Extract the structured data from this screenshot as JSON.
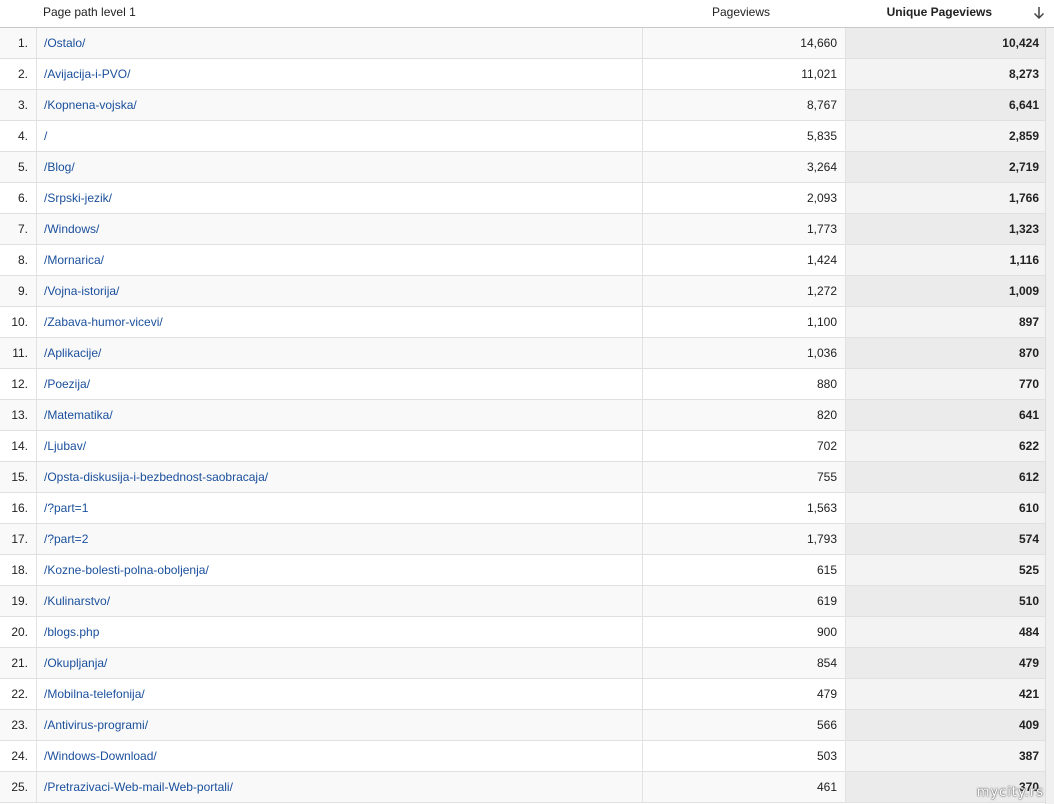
{
  "header": {
    "path_label": "Page path level 1",
    "pageviews_label": "Pageviews",
    "unique_label": "Unique Pageviews"
  },
  "icons": {
    "sort": "arrow-down-icon"
  },
  "rows": [
    {
      "num": "1.",
      "path": "/Ostalo/",
      "pageviews": "14,660",
      "unique": "10,424"
    },
    {
      "num": "2.",
      "path": "/Avijacija-i-PVO/",
      "pageviews": "11,021",
      "unique": "8,273"
    },
    {
      "num": "3.",
      "path": "/Kopnena-vojska/",
      "pageviews": "8,767",
      "unique": "6,641"
    },
    {
      "num": "4.",
      "path": "/",
      "pageviews": "5,835",
      "unique": "2,859"
    },
    {
      "num": "5.",
      "path": "/Blog/",
      "pageviews": "3,264",
      "unique": "2,719"
    },
    {
      "num": "6.",
      "path": "/Srpski-jezik/",
      "pageviews": "2,093",
      "unique": "1,766"
    },
    {
      "num": "7.",
      "path": "/Windows/",
      "pageviews": "1,773",
      "unique": "1,323"
    },
    {
      "num": "8.",
      "path": "/Mornarica/",
      "pageviews": "1,424",
      "unique": "1,116"
    },
    {
      "num": "9.",
      "path": "/Vojna-istorija/",
      "pageviews": "1,272",
      "unique": "1,009"
    },
    {
      "num": "10.",
      "path": "/Zabava-humor-vicevi/",
      "pageviews": "1,100",
      "unique": "897"
    },
    {
      "num": "11.",
      "path": "/Aplikacije/",
      "pageviews": "1,036",
      "unique": "870"
    },
    {
      "num": "12.",
      "path": "/Poezija/",
      "pageviews": "880",
      "unique": "770"
    },
    {
      "num": "13.",
      "path": "/Matematika/",
      "pageviews": "820",
      "unique": "641"
    },
    {
      "num": "14.",
      "path": "/Ljubav/",
      "pageviews": "702",
      "unique": "622"
    },
    {
      "num": "15.",
      "path": "/Opsta-diskusija-i-bezbednost-saobracaja/",
      "pageviews": "755",
      "unique": "612"
    },
    {
      "num": "16.",
      "path": "/?part=1",
      "pageviews": "1,563",
      "unique": "610"
    },
    {
      "num": "17.",
      "path": "/?part=2",
      "pageviews": "1,793",
      "unique": "574"
    },
    {
      "num": "18.",
      "path": "/Kozne-bolesti-polna-oboljenja/",
      "pageviews": "615",
      "unique": "525"
    },
    {
      "num": "19.",
      "path": "/Kulinarstvo/",
      "pageviews": "619",
      "unique": "510"
    },
    {
      "num": "20.",
      "path": "/blogs.php",
      "pageviews": "900",
      "unique": "484"
    },
    {
      "num": "21.",
      "path": "/Okupljanja/",
      "pageviews": "854",
      "unique": "479"
    },
    {
      "num": "22.",
      "path": "/Mobilna-telefonija/",
      "pageviews": "479",
      "unique": "421"
    },
    {
      "num": "23.",
      "path": "/Antivirus-programi/",
      "pageviews": "566",
      "unique": "409"
    },
    {
      "num": "24.",
      "path": "/Windows-Download/",
      "pageviews": "503",
      "unique": "387"
    },
    {
      "num": "25.",
      "path": "/Pretrazivaci-Web-mail-Web-portali/",
      "pageviews": "461",
      "unique": "370"
    }
  ],
  "watermark": "mycity.rs"
}
